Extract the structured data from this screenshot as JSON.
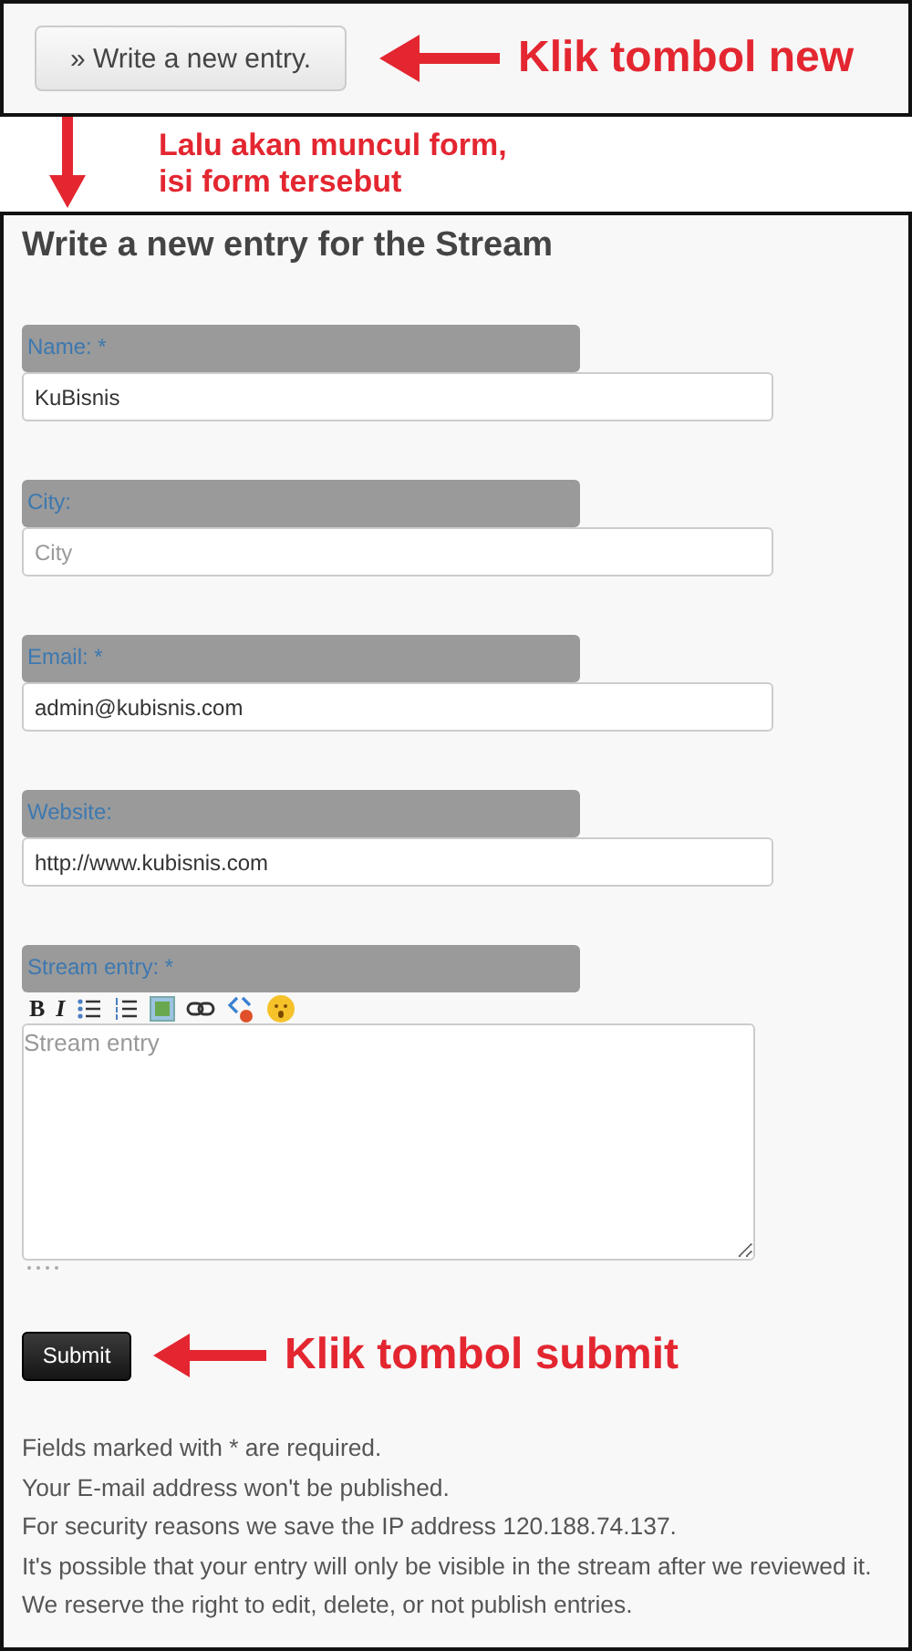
{
  "top_panel": {
    "button": "» Write a new entry.",
    "annotation": "Klik tombol new"
  },
  "middle_annotation": [
    "Lalu akan muncul form,",
    "isi form tersebut"
  ],
  "form": {
    "title": "Write a new entry for the Stream",
    "fields": [
      {
        "kind": "text",
        "label": "Name: *",
        "value": "KuBisnis"
      },
      {
        "kind": "text",
        "label": "City:",
        "placeholder": "City"
      },
      {
        "kind": "text",
        "label": "Email: *",
        "value": "admin@kubisnis.com"
      },
      {
        "kind": "text",
        "label": "Website:",
        "value": "http://www.kubisnis.com"
      },
      {
        "kind": "textarea",
        "label": "Stream entry: *",
        "placeholder": "Stream entry"
      }
    ],
    "toolbar": [
      {
        "kind": "bold",
        "label": "B"
      },
      {
        "kind": "italic",
        "label": "I"
      },
      {
        "kind": "bullet-list"
      },
      {
        "kind": "numbered-list"
      },
      {
        "kind": "image"
      },
      {
        "kind": "link"
      },
      {
        "kind": "code"
      },
      {
        "kind": "emoji"
      }
    ],
    "submit": "Submit",
    "submit_annotation": "Klik tombol submit",
    "notes": [
      "Fields marked with * are required.",
      "Your E-mail address won't be published.",
      "For security reasons we save the IP address 120.188.74.137.",
      "It's possible that your entry will only be visible in the stream after we reviewed it.",
      "We reserve the right to edit, delete, or not publish entries."
    ]
  }
}
